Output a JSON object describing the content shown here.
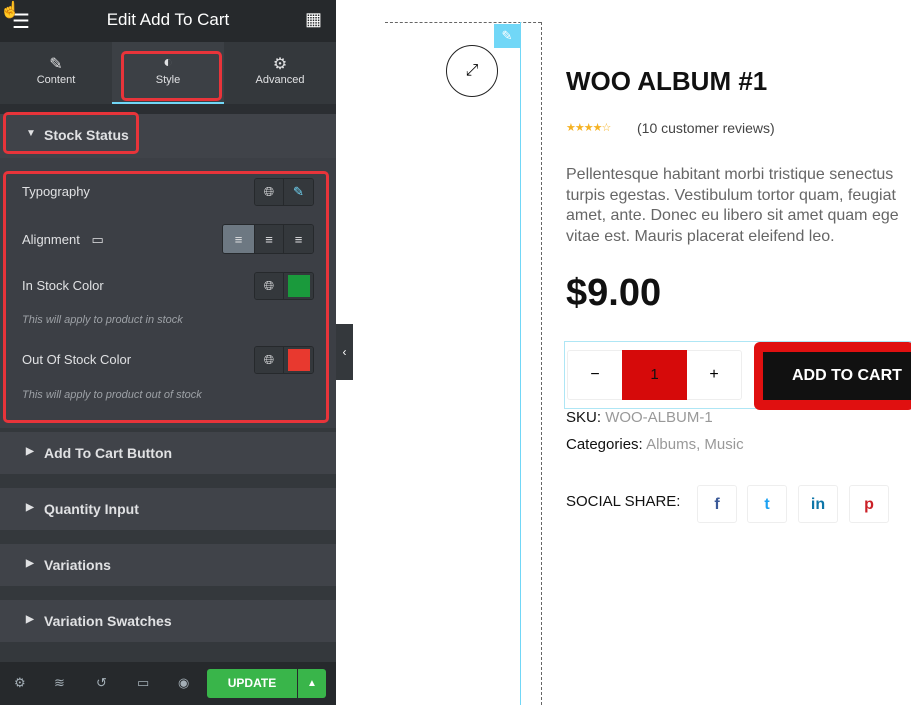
{
  "editor": {
    "title": "Edit Add To Cart",
    "tabs": [
      {
        "label": "Content",
        "icon": "pencil-icon"
      },
      {
        "label": "Style",
        "icon": "contrast-icon"
      },
      {
        "label": "Advanced",
        "icon": "gear-icon"
      }
    ],
    "active_tab": "Style",
    "section": {
      "title": "Stock Status",
      "typography": "Typography",
      "alignment": "Alignment",
      "in_stock_color": "In Stock Color",
      "in_stock_note": "This will apply to product in stock",
      "in_stock_value": "#1a9a3c",
      "out_stock_color": "Out Of Stock Color",
      "out_stock_note": "This will apply to product out of stock",
      "out_stock_value": "#e8392f"
    },
    "collapsed_sections": [
      "Add To Cart Button",
      "Quantity Input",
      "Variations",
      "Variation Swatches"
    ],
    "footer": {
      "update": "UPDATE"
    },
    "highlight_color": "#e8343a",
    "accent": "#71d7f7"
  },
  "product": {
    "title": "WOO ALBUM #1",
    "rating": 3.5,
    "stars": "★★★★☆",
    "reviews": "(10 customer reviews)",
    "description": [
      "Pellentesque habitant morbi tristique senectus",
      "turpis egestas. Vestibulum tortor quam, feugiat",
      "amet, ante. Donec eu libero sit amet quam ege",
      "vitae est. Mauris placerat eleifend leo."
    ],
    "price": "$9.00",
    "qty_minus": "−",
    "quantity": "1",
    "qty_plus": "+",
    "add_to_cart": "ADD TO CART",
    "sku_label": "SKU:",
    "sku": "WOO-ALBUM-1",
    "categories_label": "Categories:",
    "categories": "Albums, Music",
    "social_label": "SOCIAL SHARE:",
    "social": [
      "f",
      "t",
      "in",
      "p"
    ]
  }
}
